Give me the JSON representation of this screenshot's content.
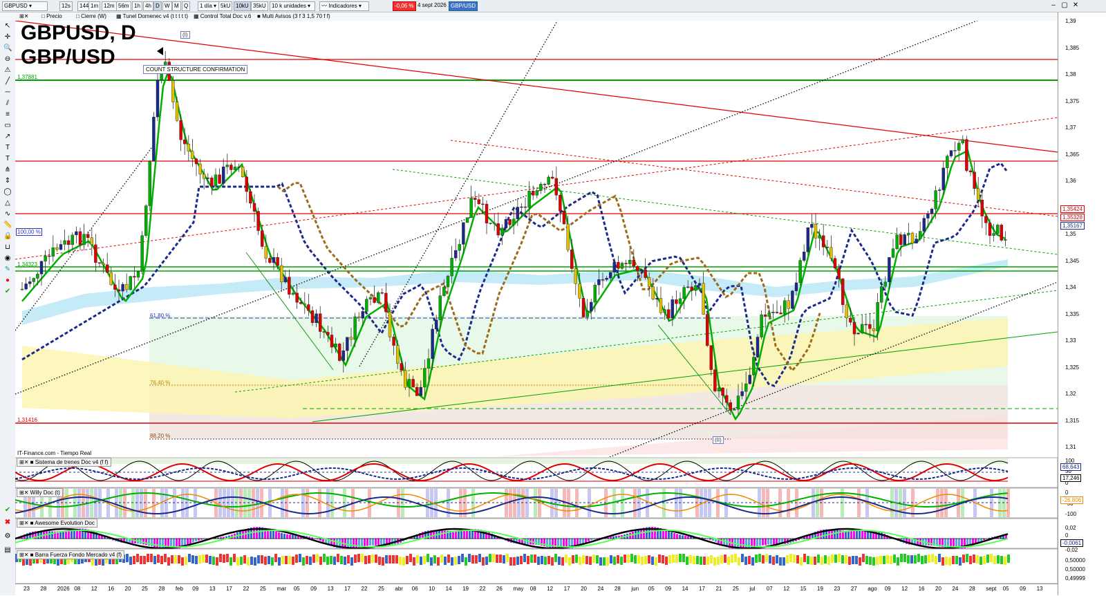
{
  "toolbar": {
    "symbol": "GBPUSD",
    "timeframes": [
      "12s",
      "144s",
      "1m",
      "12m",
      "56m",
      "1h",
      "4h",
      "D",
      "W",
      "M",
      "Q"
    ],
    "period": "1 día",
    "units": [
      "5kU",
      "10kU",
      "35kU"
    ],
    "quantity": "10 k unidades",
    "indicators_label": "Indicadores",
    "change_pct": "-0,06 %",
    "date": "4 sept 2026",
    "ticker_tag": "GBP/USD"
  },
  "subbar": {
    "items": [
      "Precio",
      "Cierre (W)",
      "Tunel Domenec v4 (t t t t t)",
      "Control Total Doc v.6",
      "Multi Avisos (3 f 3 1,5 70 f f)"
    ]
  },
  "chart": {
    "title_line1": "GBPUSD, D",
    "title_line2": "GBP/USD",
    "wave_label_top": "(I)",
    "wave_label_bottom": "(II)",
    "annotation": "COUNT STRUCTURE CONFIRMATION",
    "level_high": "1,37881",
    "level_low": "1,31416",
    "level_mid": "1,34323",
    "pct_100": "100,00 %",
    "fib_618": "61,80 %",
    "fib_764": "76,40 %",
    "fib_882": "88,20 %",
    "source": "IT-Finance.com - Tiempo Real"
  },
  "price_axis": {
    "ticks": [
      "1,39",
      "1,385",
      "1,38",
      "1,375",
      "1,37",
      "1,365",
      "1,36",
      "1,355",
      "1,35",
      "1,345",
      "1,34",
      "1,335",
      "1,33",
      "1,325",
      "1,32",
      "1,315",
      "1,31"
    ],
    "tags": [
      "1,35424",
      "1,35328",
      "1,35167"
    ]
  },
  "panels": {
    "trenes": {
      "title": "Sistema de trenes Doc v4 (f f)",
      "ticks": [
        "100",
        "50",
        "0"
      ],
      "tags": [
        "68,643",
        "17,246"
      ]
    },
    "willy": {
      "title": "Willy Doc (t)",
      "ticks": [
        "0",
        "-50",
        "-100"
      ],
      "tags": [
        "-26,806"
      ]
    },
    "awesome": {
      "title": "Awesome Evolution Doc",
      "ticks": [
        "0,02",
        "0",
        "-0,02"
      ],
      "tags": [
        "-0,0061"
      ]
    },
    "barra": {
      "title": "Barra Fuerza Fondo Mercado v4 (f)",
      "ticks": [
        "0,50000",
        "0,50000",
        "0,49999"
      ]
    }
  },
  "date_axis": [
    "23",
    "28",
    "2026",
    "08",
    "12",
    "16",
    "20",
    "25",
    "28",
    "feb",
    "09",
    "13",
    "17",
    "22",
    "25",
    "mar",
    "05",
    "09",
    "13",
    "17",
    "22",
    "25",
    "abr",
    "06",
    "10",
    "14",
    "19",
    "22",
    "26",
    "may",
    "08",
    "12",
    "17",
    "20",
    "24",
    "28",
    "jun",
    "05",
    "09",
    "14",
    "17",
    "21",
    "25",
    "jul",
    "07",
    "12",
    "15",
    "19",
    "23",
    "27",
    "ago",
    "09",
    "12",
    "16",
    "20",
    "24",
    "28",
    "sept",
    "05",
    "09",
    "13"
  ],
  "colors": {
    "bull": "#00b000",
    "bear": "#e00000",
    "navy": "#1a2a8a",
    "brown": "#9b6a1b",
    "green_line": "#00a000",
    "red_line": "#e00000"
  }
}
